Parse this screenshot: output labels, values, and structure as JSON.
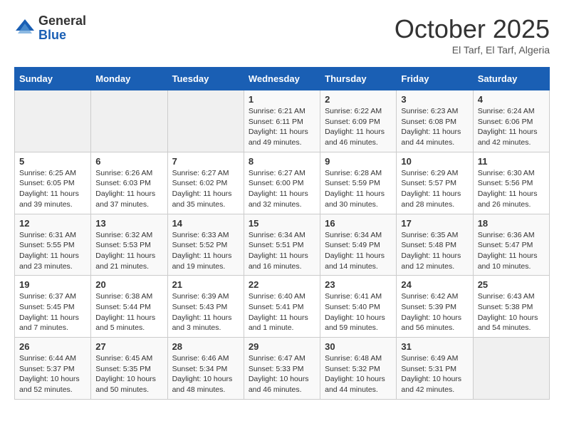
{
  "header": {
    "logo_general": "General",
    "logo_blue": "Blue",
    "title": "October 2025",
    "location": "El Tarf, El Tarf, Algeria"
  },
  "weekdays": [
    "Sunday",
    "Monday",
    "Tuesday",
    "Wednesday",
    "Thursday",
    "Friday",
    "Saturday"
  ],
  "weeks": [
    [
      {
        "day": "",
        "sunrise": "",
        "sunset": "",
        "daylight": ""
      },
      {
        "day": "",
        "sunrise": "",
        "sunset": "",
        "daylight": ""
      },
      {
        "day": "",
        "sunrise": "",
        "sunset": "",
        "daylight": ""
      },
      {
        "day": "1",
        "sunrise": "Sunrise: 6:21 AM",
        "sunset": "Sunset: 6:11 PM",
        "daylight": "Daylight: 11 hours and 49 minutes."
      },
      {
        "day": "2",
        "sunrise": "Sunrise: 6:22 AM",
        "sunset": "Sunset: 6:09 PM",
        "daylight": "Daylight: 11 hours and 46 minutes."
      },
      {
        "day": "3",
        "sunrise": "Sunrise: 6:23 AM",
        "sunset": "Sunset: 6:08 PM",
        "daylight": "Daylight: 11 hours and 44 minutes."
      },
      {
        "day": "4",
        "sunrise": "Sunrise: 6:24 AM",
        "sunset": "Sunset: 6:06 PM",
        "daylight": "Daylight: 11 hours and 42 minutes."
      }
    ],
    [
      {
        "day": "5",
        "sunrise": "Sunrise: 6:25 AM",
        "sunset": "Sunset: 6:05 PM",
        "daylight": "Daylight: 11 hours and 39 minutes."
      },
      {
        "day": "6",
        "sunrise": "Sunrise: 6:26 AM",
        "sunset": "Sunset: 6:03 PM",
        "daylight": "Daylight: 11 hours and 37 minutes."
      },
      {
        "day": "7",
        "sunrise": "Sunrise: 6:27 AM",
        "sunset": "Sunset: 6:02 PM",
        "daylight": "Daylight: 11 hours and 35 minutes."
      },
      {
        "day": "8",
        "sunrise": "Sunrise: 6:27 AM",
        "sunset": "Sunset: 6:00 PM",
        "daylight": "Daylight: 11 hours and 32 minutes."
      },
      {
        "day": "9",
        "sunrise": "Sunrise: 6:28 AM",
        "sunset": "Sunset: 5:59 PM",
        "daylight": "Daylight: 11 hours and 30 minutes."
      },
      {
        "day": "10",
        "sunrise": "Sunrise: 6:29 AM",
        "sunset": "Sunset: 5:57 PM",
        "daylight": "Daylight: 11 hours and 28 minutes."
      },
      {
        "day": "11",
        "sunrise": "Sunrise: 6:30 AM",
        "sunset": "Sunset: 5:56 PM",
        "daylight": "Daylight: 11 hours and 26 minutes."
      }
    ],
    [
      {
        "day": "12",
        "sunrise": "Sunrise: 6:31 AM",
        "sunset": "Sunset: 5:55 PM",
        "daylight": "Daylight: 11 hours and 23 minutes."
      },
      {
        "day": "13",
        "sunrise": "Sunrise: 6:32 AM",
        "sunset": "Sunset: 5:53 PM",
        "daylight": "Daylight: 11 hours and 21 minutes."
      },
      {
        "day": "14",
        "sunrise": "Sunrise: 6:33 AM",
        "sunset": "Sunset: 5:52 PM",
        "daylight": "Daylight: 11 hours and 19 minutes."
      },
      {
        "day": "15",
        "sunrise": "Sunrise: 6:34 AM",
        "sunset": "Sunset: 5:51 PM",
        "daylight": "Daylight: 11 hours and 16 minutes."
      },
      {
        "day": "16",
        "sunrise": "Sunrise: 6:34 AM",
        "sunset": "Sunset: 5:49 PM",
        "daylight": "Daylight: 11 hours and 14 minutes."
      },
      {
        "day": "17",
        "sunrise": "Sunrise: 6:35 AM",
        "sunset": "Sunset: 5:48 PM",
        "daylight": "Daylight: 11 hours and 12 minutes."
      },
      {
        "day": "18",
        "sunrise": "Sunrise: 6:36 AM",
        "sunset": "Sunset: 5:47 PM",
        "daylight": "Daylight: 11 hours and 10 minutes."
      }
    ],
    [
      {
        "day": "19",
        "sunrise": "Sunrise: 6:37 AM",
        "sunset": "Sunset: 5:45 PM",
        "daylight": "Daylight: 11 hours and 7 minutes."
      },
      {
        "day": "20",
        "sunrise": "Sunrise: 6:38 AM",
        "sunset": "Sunset: 5:44 PM",
        "daylight": "Daylight: 11 hours and 5 minutes."
      },
      {
        "day": "21",
        "sunrise": "Sunrise: 6:39 AM",
        "sunset": "Sunset: 5:43 PM",
        "daylight": "Daylight: 11 hours and 3 minutes."
      },
      {
        "day": "22",
        "sunrise": "Sunrise: 6:40 AM",
        "sunset": "Sunset: 5:41 PM",
        "daylight": "Daylight: 11 hours and 1 minute."
      },
      {
        "day": "23",
        "sunrise": "Sunrise: 6:41 AM",
        "sunset": "Sunset: 5:40 PM",
        "daylight": "Daylight: 10 hours and 59 minutes."
      },
      {
        "day": "24",
        "sunrise": "Sunrise: 6:42 AM",
        "sunset": "Sunset: 5:39 PM",
        "daylight": "Daylight: 10 hours and 56 minutes."
      },
      {
        "day": "25",
        "sunrise": "Sunrise: 6:43 AM",
        "sunset": "Sunset: 5:38 PM",
        "daylight": "Daylight: 10 hours and 54 minutes."
      }
    ],
    [
      {
        "day": "26",
        "sunrise": "Sunrise: 6:44 AM",
        "sunset": "Sunset: 5:37 PM",
        "daylight": "Daylight: 10 hours and 52 minutes."
      },
      {
        "day": "27",
        "sunrise": "Sunrise: 6:45 AM",
        "sunset": "Sunset: 5:35 PM",
        "daylight": "Daylight: 10 hours and 50 minutes."
      },
      {
        "day": "28",
        "sunrise": "Sunrise: 6:46 AM",
        "sunset": "Sunset: 5:34 PM",
        "daylight": "Daylight: 10 hours and 48 minutes."
      },
      {
        "day": "29",
        "sunrise": "Sunrise: 6:47 AM",
        "sunset": "Sunset: 5:33 PM",
        "daylight": "Daylight: 10 hours and 46 minutes."
      },
      {
        "day": "30",
        "sunrise": "Sunrise: 6:48 AM",
        "sunset": "Sunset: 5:32 PM",
        "daylight": "Daylight: 10 hours and 44 minutes."
      },
      {
        "day": "31",
        "sunrise": "Sunrise: 6:49 AM",
        "sunset": "Sunset: 5:31 PM",
        "daylight": "Daylight: 10 hours and 42 minutes."
      },
      {
        "day": "",
        "sunrise": "",
        "sunset": "",
        "daylight": ""
      }
    ]
  ]
}
